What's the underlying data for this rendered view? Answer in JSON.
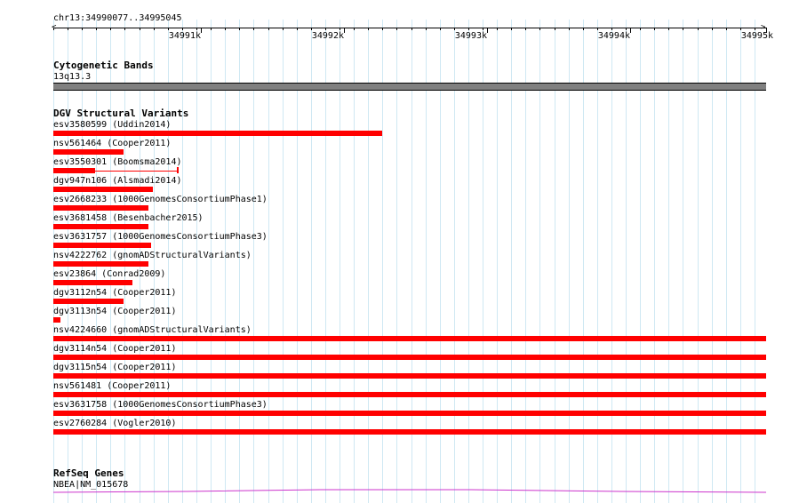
{
  "ruler": {
    "range": "chr13:34990077..34995045",
    "ticks": [
      "34991k",
      "34992k",
      "34993k",
      "34994k",
      "34995k"
    ]
  },
  "cytoband": {
    "title": "Cytogenetic Bands",
    "label": "13q13.3"
  },
  "dgv": {
    "title": "DGV Structural Variants",
    "variants": [
      {
        "label": "esv3580599 (Uddin2014)"
      },
      {
        "label": "nsv561464 (Cooper2011)"
      },
      {
        "label": "esv3550301 (Boomsma2014)"
      },
      {
        "label": "dgv947n106 (Alsmadi2014)"
      },
      {
        "label": "esv2668233 (1000GenomesConsortiumPhase1)"
      },
      {
        "label": "esv3681458 (Besenbacher2015)"
      },
      {
        "label": "esv3631757 (1000GenomesConsortiumPhase3)"
      },
      {
        "label": "nsv4222762 (gnomADStructuralVariants)"
      },
      {
        "label": "esv23864 (Conrad2009)"
      },
      {
        "label": "dgv3112n54 (Cooper2011)"
      },
      {
        "label": "dgv3113n54 (Cooper2011)"
      },
      {
        "label": "nsv4224660 (gnomADStructuralVariants)"
      },
      {
        "label": "dgv3114n54 (Cooper2011)"
      },
      {
        "label": "dgv3115n54 (Cooper2011)"
      },
      {
        "label": "nsv561481 (Cooper2011)"
      },
      {
        "label": "esv3631758 (1000GenomesConsortiumPhase3)"
      },
      {
        "label": "esv2760284 (Vogler2010)"
      }
    ]
  },
  "refseq": {
    "title": "RefSeq Genes",
    "label": "NBEA|NM_015678"
  },
  "colors": {
    "variant": "#ff0000",
    "gene": "#cc33cc",
    "grid": "#cfe8f3",
    "band": "#808080"
  }
}
